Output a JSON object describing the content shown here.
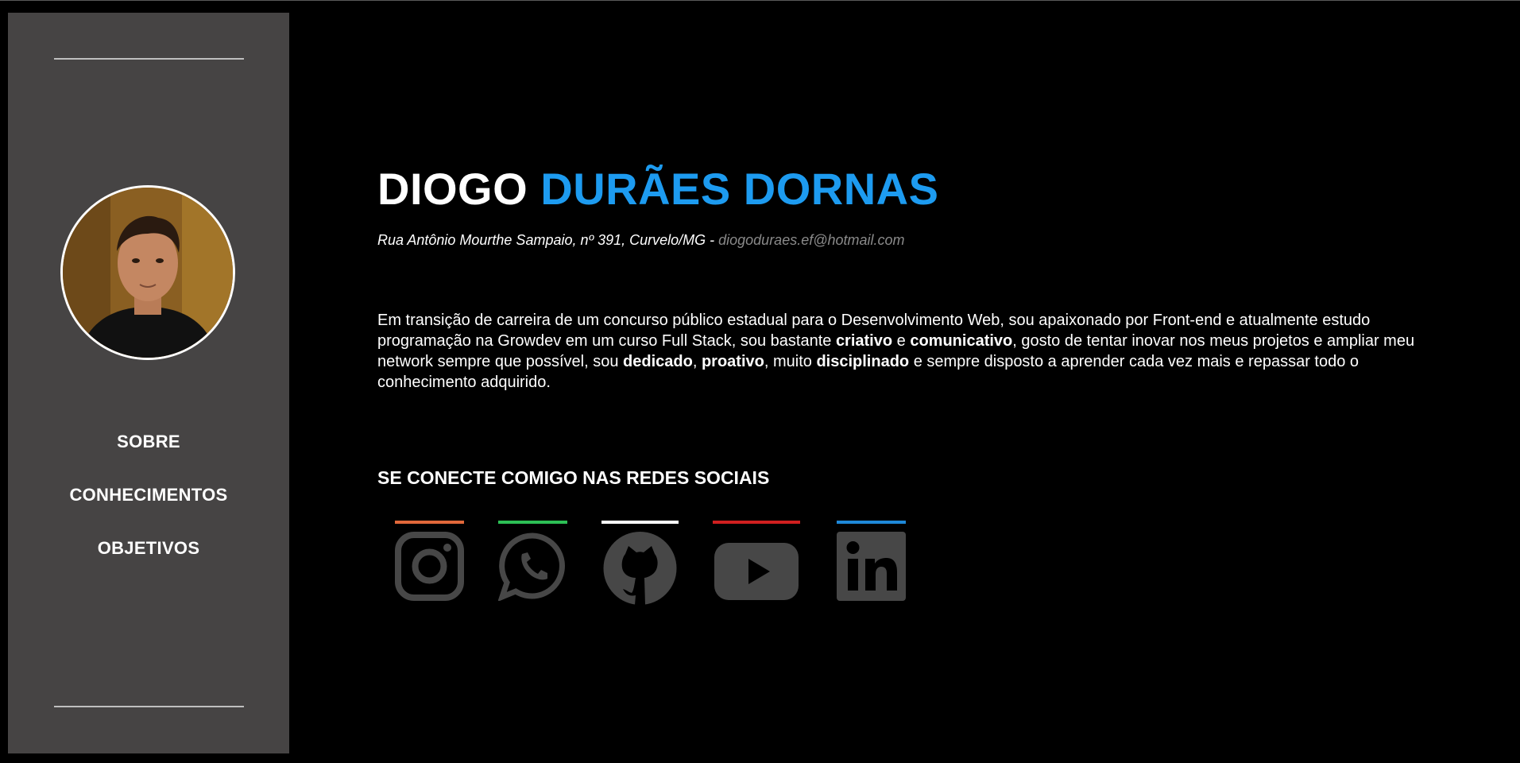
{
  "sidebar": {
    "avatar_alt": "Foto de perfil",
    "nav": [
      {
        "label": "SOBRE"
      },
      {
        "label": "CONHECIMENTOS"
      },
      {
        "label": "OBJETIVOS"
      }
    ]
  },
  "header": {
    "first_name": "DIOGO",
    "last_name": "DURÃES DORNAS",
    "address": "Rua Antônio Mourthe Sampaio, nº 391, Curvelo/MG - ",
    "email": "diogoduraes.ef@hotmail.com"
  },
  "bio": {
    "p1": "Em transição de carreira de um concurso público estadual para o Desenvolvimento Web, sou apaixonado por Front-end e atualmente estudo programação na Growdev em um curso Full Stack, sou bastante ",
    "b1": "criativo",
    "p2": " e ",
    "b2": "comunicativo",
    "p3": ", gosto de tentar inovar nos meus projetos e ampliar meu network sempre que possível, sou ",
    "b3": "dedicado",
    "p4": ", ",
    "b4": "proativo",
    "p5": ", muito ",
    "b5": "disciplinado",
    "p6": " e sempre disposto a aprender cada vez mais e repassar todo o conhecimento adquirido."
  },
  "social": {
    "title": "SE CONECTE COMIGO NAS REDES SOCIAIS",
    "links": [
      {
        "name": "instagram-icon",
        "accent": "#e1683a"
      },
      {
        "name": "whatsapp-icon",
        "accent": "#2dbf55"
      },
      {
        "name": "github-icon",
        "accent": "#ffffff"
      },
      {
        "name": "youtube-icon",
        "accent": "#d01f1f"
      },
      {
        "name": "linkedin-icon",
        "accent": "#1e88d8"
      }
    ]
  },
  "colors": {
    "background": "#000000",
    "sidebar": "#464444",
    "accent": "#1d9bf0",
    "icon": "#474747"
  }
}
